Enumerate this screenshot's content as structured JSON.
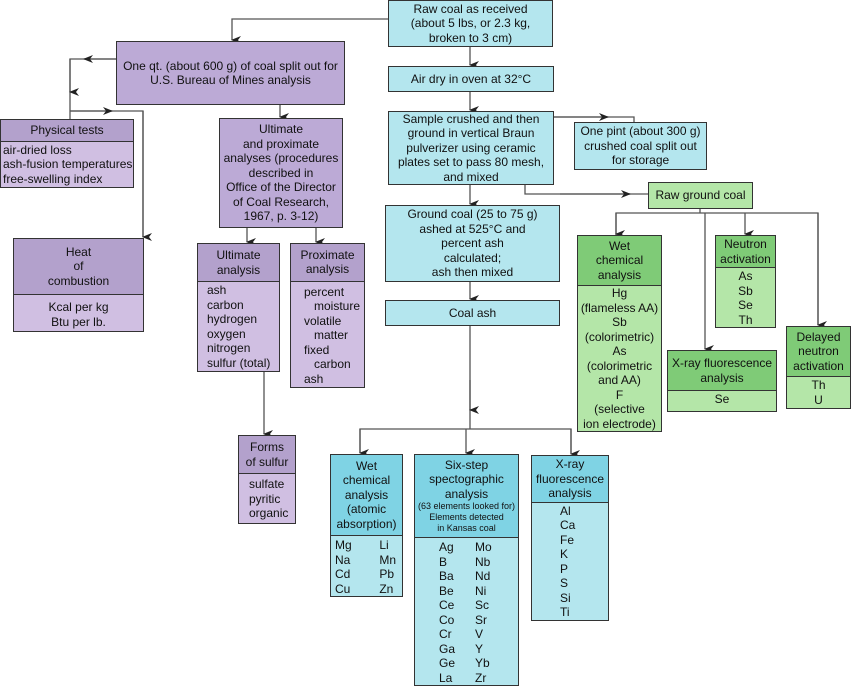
{
  "raw_coal": [
    "Raw coal as received",
    "(about 5 lbs, or 2.3 kg,",
    "broken to 3 cm)"
  ],
  "air_dry": "Air dry in oven at 32°C",
  "sample_crushed": [
    "Sample crushed and then",
    "ground in vertical Braun",
    "pulverizer using ceramic",
    "plates set to pass 80 mesh,",
    "and mixed"
  ],
  "one_pint": [
    "One pint (about 300 g)",
    "crushed coal split out",
    "for storage"
  ],
  "ground_coal": [
    "Ground coal (25 to 75 g)",
    "ashed at 525°C and",
    "percent ash",
    "calculated;",
    "ash then mixed"
  ],
  "coal_ash": "Coal ash",
  "raw_ground_coal": "Raw ground coal",
  "green_wet": {
    "title": [
      "Wet",
      "chemical",
      "analysis"
    ],
    "items": [
      "Hg",
      "(flameless AA)",
      "Sb",
      "(colorimetric)",
      "As",
      "(colorimetric",
      "and AA)",
      "F",
      "(selective",
      "ion electrode)"
    ]
  },
  "neutron": {
    "title": [
      "Neutron",
      "activation"
    ],
    "items": [
      "As",
      "Sb",
      "Se",
      "Th"
    ]
  },
  "xray_green": {
    "title": [
      "X-ray fluorescence",
      "analysis"
    ],
    "items": [
      "Se"
    ]
  },
  "delayed": {
    "title": [
      "Delayed",
      "neutron",
      "activation"
    ],
    "items": [
      "Th",
      "U"
    ]
  },
  "one_qt": [
    "One qt. (about 600 g) of coal split out for",
    "U.S. Bureau of Mines analysis"
  ],
  "physical": {
    "title": "Physical tests",
    "items": [
      "air-dried loss",
      "ash-fusion temperatures",
      "free-swelling index"
    ]
  },
  "heat": {
    "title": [
      "Heat",
      "of",
      "combustion"
    ],
    "items": [
      "Kcal per kg",
      "Btu per lb."
    ]
  },
  "ult_prox": [
    "Ultimate",
    "and proximate",
    "analyses (procedures",
    "described in",
    "Office of the Director",
    "of Coal Research,",
    "1967, p. 3-12)"
  ],
  "ultimate": {
    "title": [
      "Ultimate",
      "analysis"
    ],
    "items": [
      "ash",
      "carbon",
      "hydrogen",
      "oxygen",
      "nitrogen",
      "sulfur (total)"
    ]
  },
  "proximate": {
    "title": [
      "Proximate",
      "analysis"
    ],
    "items": [
      "percent",
      "moisture",
      "volatile",
      "matter",
      "fixed",
      "carbon",
      "ash"
    ]
  },
  "sulfur": {
    "title": [
      "Forms",
      "of sulfur"
    ],
    "items": [
      "sulfate",
      "pyritic",
      "organic"
    ]
  },
  "blue_wet": {
    "title": [
      "Wet",
      "chemical",
      "analysis",
      "(atomic",
      "absorption)"
    ],
    "col1": [
      "Mg",
      "Na",
      "Cd",
      "Cu"
    ],
    "col2": [
      "Li",
      "Mn",
      "Pb",
      "Zn"
    ]
  },
  "six_step": {
    "title": [
      "Six-step",
      "spectographic",
      "analysis"
    ],
    "note": [
      "(63 elements looked for)",
      "Elements detected",
      "in Kansas coal"
    ],
    "col1": [
      "Ag",
      "B",
      "Ba",
      "Be",
      "Ce",
      "Co",
      "Cr",
      "Ga",
      "Ge",
      "La"
    ],
    "col2": [
      "Mo",
      "Nb",
      "Nd",
      "Ni",
      "Sc",
      "Sr",
      "V",
      "Y",
      "Yb",
      "Zr"
    ]
  },
  "xray_blue": {
    "title": [
      "X-ray",
      "fluorescence",
      "analysis"
    ],
    "items": [
      "Al",
      "Ca",
      "Fe",
      "K",
      "P",
      "S",
      "Si",
      "Ti"
    ]
  },
  "colors": {
    "blue": "#b4e6ee",
    "blue_header": "#7fd3e4",
    "purple": "#bcaad6",
    "purple_header": "#b3a1cc",
    "purple_body": "#d0bfe2",
    "green": "#b4e6a8",
    "green_header": "#7fcb77"
  }
}
